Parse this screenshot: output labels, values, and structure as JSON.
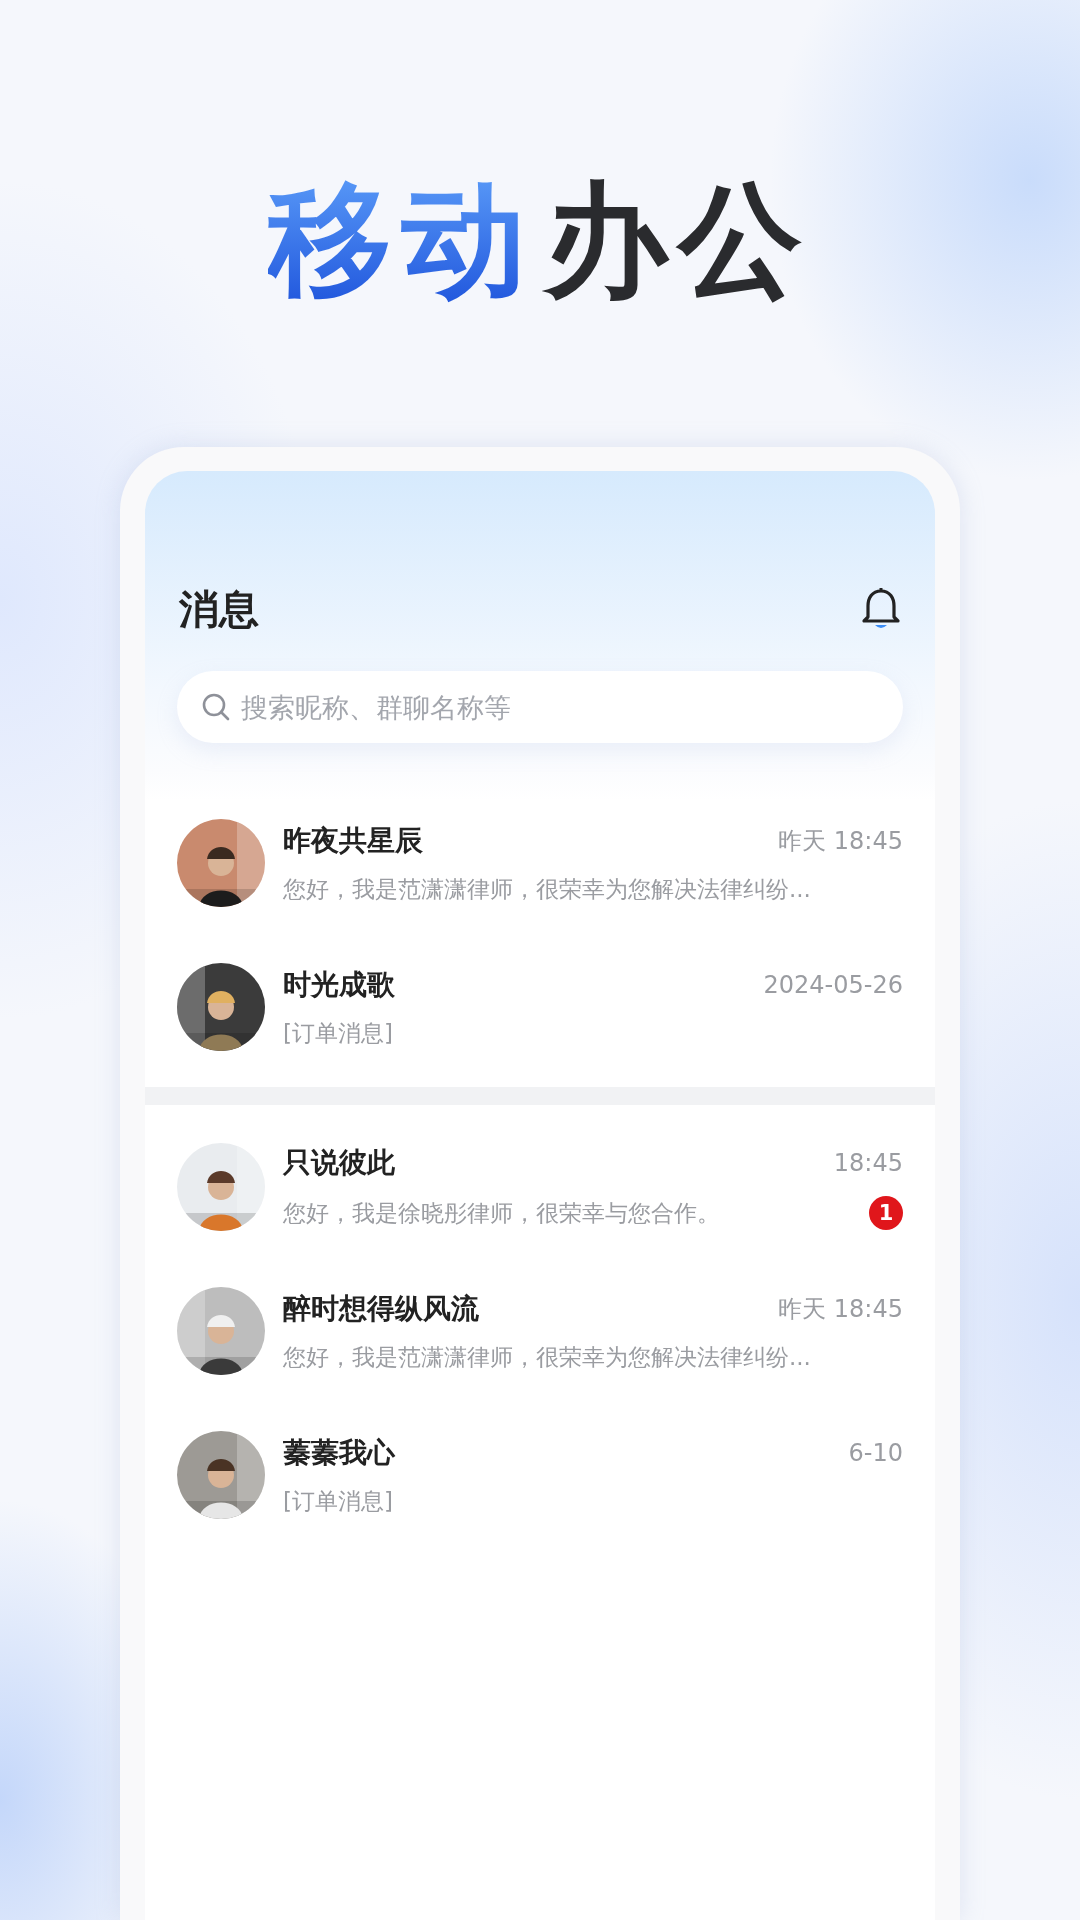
{
  "headline": [
    {
      "text": "移动",
      "accent": true
    },
    {
      "text": "办公",
      "accent": false
    }
  ],
  "screen": {
    "title": "消息",
    "search": {
      "placeholder": "搜索昵称、群聊名称等"
    }
  },
  "groups": [
    {
      "conversations": [
        {
          "name": "昨夜共星辰",
          "time": "昨天 18:45",
          "preview": "您好，我是范潇潇律师，很荣幸为您解决法律纠纷..."
        },
        {
          "name": "时光成歌",
          "time": "2024-05-26",
          "preview": "[订单消息]"
        }
      ]
    },
    {
      "conversations": [
        {
          "name": "只说彼此",
          "time": "18:45",
          "preview": "您好，我是徐晓彤律师，很荣幸与您合作。",
          "unread": "1"
        },
        {
          "name": "醉时想得纵风流",
          "time": "昨天 18:45",
          "preview": "您好，我是范潇潇律师，很荣幸为您解决法律纠纷..."
        },
        {
          "name": "蓁蓁我心",
          "time": "6-10",
          "preview": "[订单消息]"
        }
      ]
    }
  ]
}
